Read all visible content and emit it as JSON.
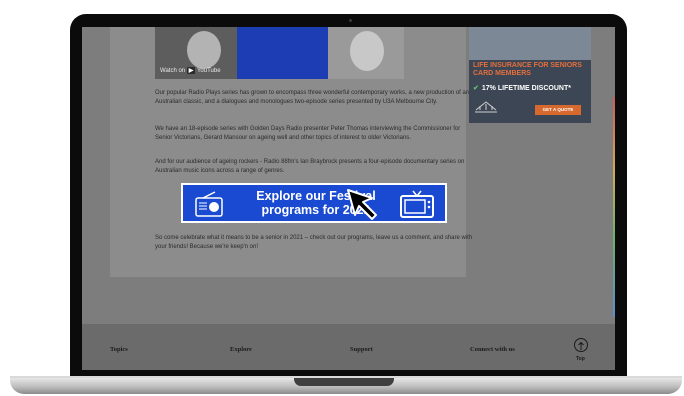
{
  "video": {
    "watch_on": "Watch on",
    "platform": "YouTube"
  },
  "article": {
    "paragraphs": [
      "Our popular Radio Plays series has grown to encompass three wonderful contemporary works, a new production of an Australian classic, and a dialogues and monologues two-episode series presented by U3A Melbourne City.",
      "We have an 18-episode series with Golden Days Radio presenter Peter Thomas interviewing the Commissioner for Senior Victorians, Gerard Mansour on ageing well and other topics of interest to older Victorians.",
      "And for our audience of ageing rockers - Radio 88fm's Ian Braybrock presents a four-episode documentary series on Australian music icons across a range of genres.",
      "So come celebrate what it means to be a senior in 2021 – check out our programs, leave us a comment, and share with your friends! Because we're keep'n on!"
    ]
  },
  "banner": {
    "text": "Explore our Festival programs for 2021",
    "color": "#1a4ad2"
  },
  "ad": {
    "title": "LIFE INSURANCE FOR SENIORS CARD MEMBERS",
    "discount": "17% LIFETIME DISCOUNT*",
    "cta": "GET A QUOTE",
    "accent": "#e46f3d"
  },
  "footer": {
    "items": [
      "Topics",
      "Explore",
      "Support",
      "Connect with us"
    ],
    "top_label": "Top"
  }
}
